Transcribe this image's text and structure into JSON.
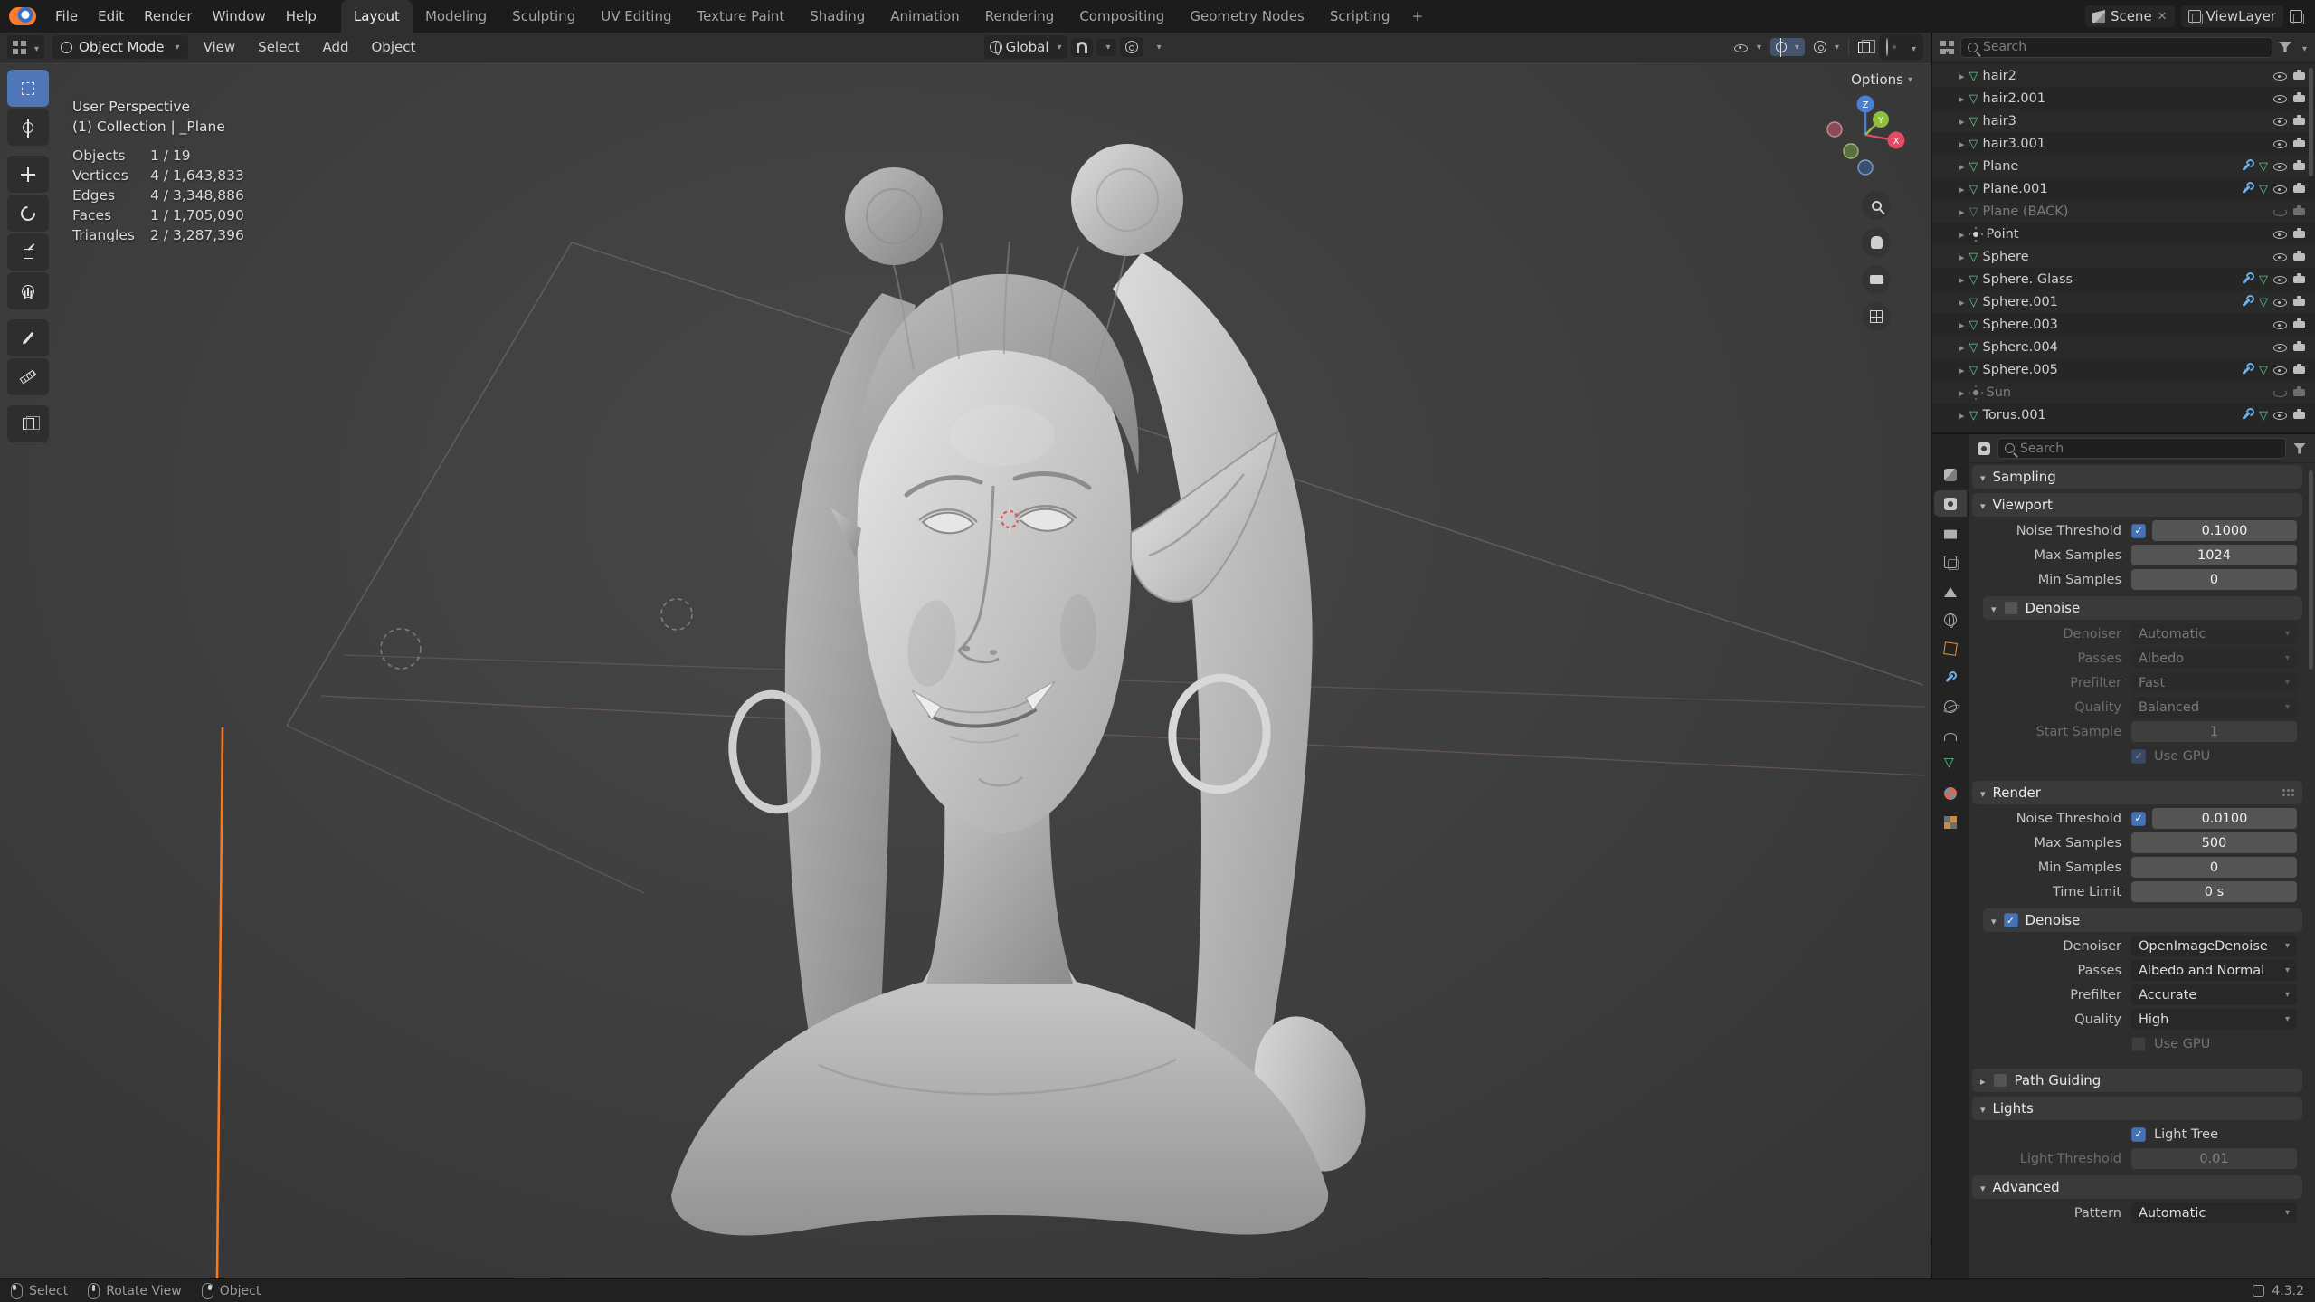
{
  "topbar": {
    "menus": [
      "File",
      "Edit",
      "Render",
      "Window",
      "Help"
    ],
    "workspaces": [
      "Layout",
      "Modeling",
      "Sculpting",
      "UV Editing",
      "Texture Paint",
      "Shading",
      "Animation",
      "Rendering",
      "Compositing",
      "Geometry Nodes",
      "Scripting"
    ],
    "add_tab": "+",
    "scene_label": "Scene",
    "viewlayer_label": "ViewLayer"
  },
  "viewport": {
    "header": {
      "mode": "Object Mode",
      "menus": [
        "View",
        "Select",
        "Add",
        "Object"
      ],
      "orientation": "Global",
      "options": "Options"
    },
    "overlay": {
      "view_name": "User Perspective",
      "context": "(1) Collection | _Plane",
      "stats": [
        {
          "label": "Objects",
          "value": "1 / 19"
        },
        {
          "label": "Vertices",
          "value": "4 / 1,643,833"
        },
        {
          "label": "Edges",
          "value": "4 / 3,348,886"
        },
        {
          "label": "Faces",
          "value": "1 / 1,705,090"
        },
        {
          "label": "Triangles",
          "value": "2 / 3,287,396"
        }
      ]
    },
    "gizmo_axes": {
      "x": "X",
      "y": "Y",
      "z": "Z"
    }
  },
  "outliner": {
    "search_placeholder": "Search",
    "items": [
      {
        "name": "hair2"
      },
      {
        "name": "hair2.001"
      },
      {
        "name": "hair3"
      },
      {
        "name": "hair3.001"
      },
      {
        "name": "Plane"
      },
      {
        "name": "Plane.001"
      },
      {
        "name": "Plane (BACK)"
      },
      {
        "name": "Point"
      },
      {
        "name": "Sphere"
      },
      {
        "name": "Sphere. Glass"
      },
      {
        "name": "Sphere.001"
      },
      {
        "name": "Sphere.003"
      },
      {
        "name": "Sphere.004"
      },
      {
        "name": "Sphere.005"
      },
      {
        "name": "Sun"
      },
      {
        "name": "Torus.001"
      }
    ]
  },
  "properties": {
    "search_placeholder": "Search",
    "tabs": [
      "tool",
      "render",
      "output",
      "view-layer",
      "scene",
      "world",
      "object",
      "modifiers",
      "physics",
      "constraints",
      "object-data",
      "material",
      "texture"
    ],
    "sampling_title": "Sampling",
    "viewport_panel": {
      "title": "Viewport",
      "noise_threshold": {
        "label": "Noise Threshold",
        "value": "0.1000"
      },
      "max_samples": {
        "label": "Max Samples",
        "value": "1024"
      },
      "min_samples": {
        "label": "Min Samples",
        "value": "0"
      },
      "denoise": {
        "title": "Denoise",
        "denoiser": {
          "label": "Denoiser",
          "value": "Automatic"
        },
        "passes": {
          "label": "Passes",
          "value": "Albedo"
        },
        "prefilter": {
          "label": "Prefilter",
          "value": "Fast"
        },
        "quality": {
          "label": "Quality",
          "value": "Balanced"
        },
        "start_sample": {
          "label": "Start Sample",
          "value": "1"
        },
        "use_gpu": "Use GPU"
      }
    },
    "render_panel": {
      "title": "Render",
      "noise_threshold": {
        "label": "Noise Threshold",
        "value": "0.0100"
      },
      "max_samples": {
        "label": "Max Samples",
        "value": "500"
      },
      "min_samples": {
        "label": "Min Samples",
        "value": "0"
      },
      "time_limit": {
        "label": "Time Limit",
        "value": "0 s"
      },
      "denoise": {
        "title": "Denoise",
        "denoiser": {
          "label": "Denoiser",
          "value": "OpenImageDenoise"
        },
        "passes": {
          "label": "Passes",
          "value": "Albedo and Normal"
        },
        "prefilter": {
          "label": "Prefilter",
          "value": "Accurate"
        },
        "quality": {
          "label": "Quality",
          "value": "High"
        },
        "use_gpu": "Use GPU"
      }
    },
    "path_guiding_title": "Path Guiding",
    "lights_panel": {
      "title": "Lights",
      "light_tree": "Light Tree",
      "light_threshold": {
        "label": "Light Threshold",
        "value": "0.01"
      }
    },
    "advanced_panel": {
      "title": "Advanced",
      "pattern": {
        "label": "Pattern",
        "value": "Automatic"
      }
    }
  },
  "statusbar": {
    "items": [
      {
        "label": "Select"
      },
      {
        "label": "Rotate View"
      },
      {
        "label": "Object"
      }
    ],
    "version": "4.3.2"
  }
}
